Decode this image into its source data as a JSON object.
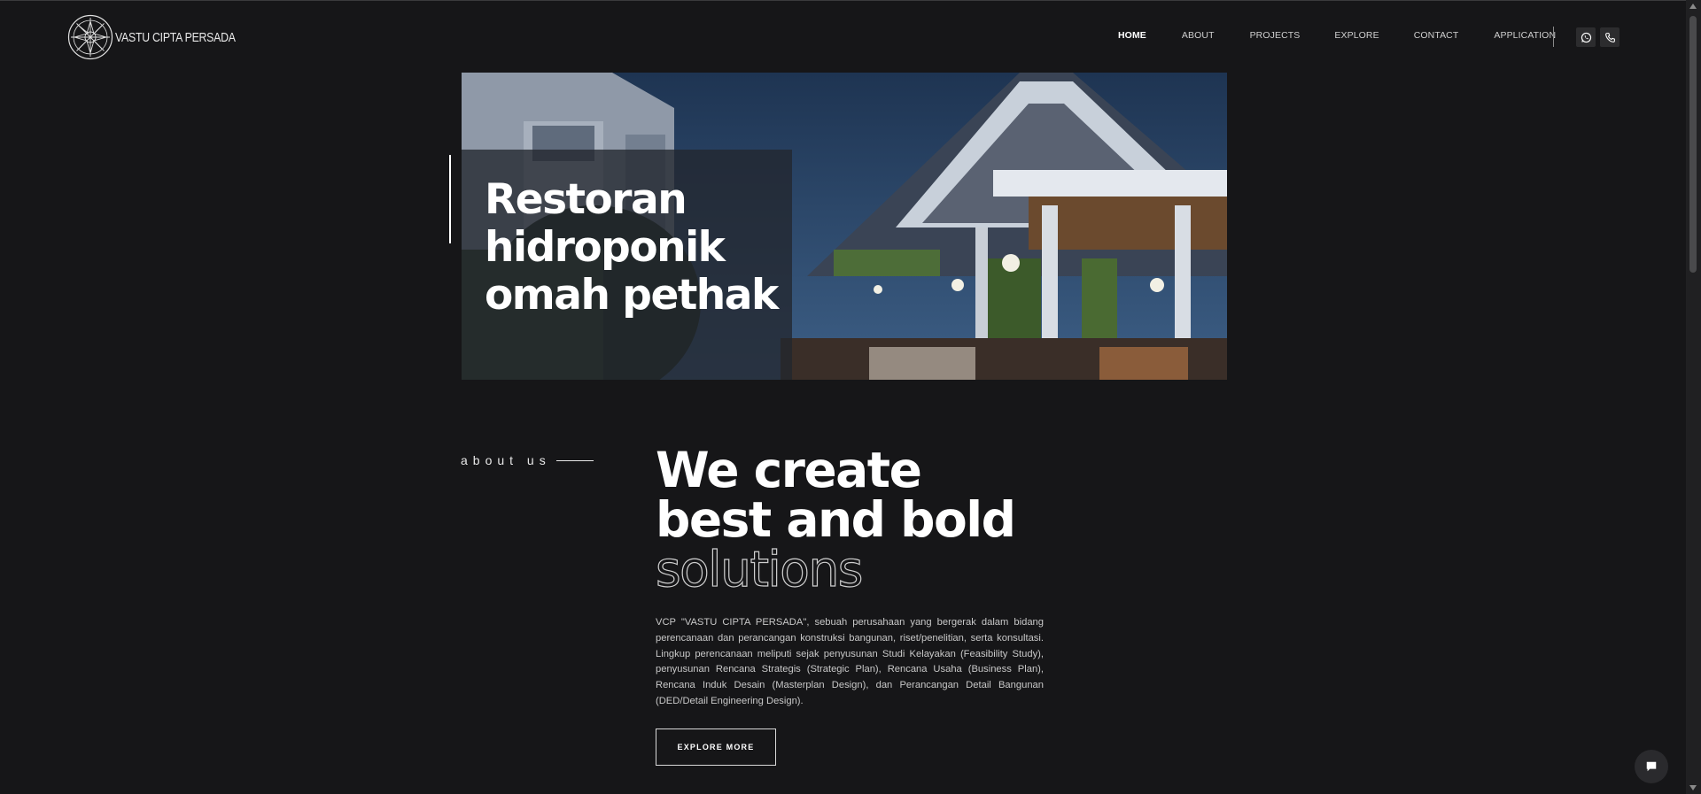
{
  "brand": {
    "name": "VASTU CIPTA PERSADA"
  },
  "nav": {
    "items": [
      {
        "label": "HOME",
        "active": true
      },
      {
        "label": "ABOUT",
        "active": false
      },
      {
        "label": "PROJECTS",
        "active": false
      },
      {
        "label": "EXPLORE",
        "active": false
      },
      {
        "label": "CONTACT",
        "active": false
      },
      {
        "label": "APPLICATION",
        "active": false
      }
    ],
    "icons": [
      "whatsapp-icon",
      "phone-icon"
    ]
  },
  "hero": {
    "title_lines": [
      "Restoran",
      "hidroponik",
      "omah pethak"
    ]
  },
  "about": {
    "label": "about us",
    "headline_lines": [
      "We create",
      "best and bold"
    ],
    "headline_outline": "solutions",
    "paragraph": "VCP \"VASTU CIPTA PERSADA\", sebuah perusahaan yang bergerak dalam bidang perencanaan dan perancangan konstruksi bangunan, riset/penelitian, serta konsultasi. Lingkup perencanaan meliputi sejak penyusunan Studi Kelayakan (Feasibility Study), penyusunan Rencana Strategis (Strategic Plan), Rencana Usaha (Business Plan), Rencana Induk Desain (Masterplan Design), dan Perancangan Detail Bangunan (DED/Detail Engineering Design).",
    "button_label": "EXPLORE MORE"
  },
  "colors": {
    "background": "#161618",
    "text": "#ffffff",
    "muted": "#c8c8c8"
  }
}
